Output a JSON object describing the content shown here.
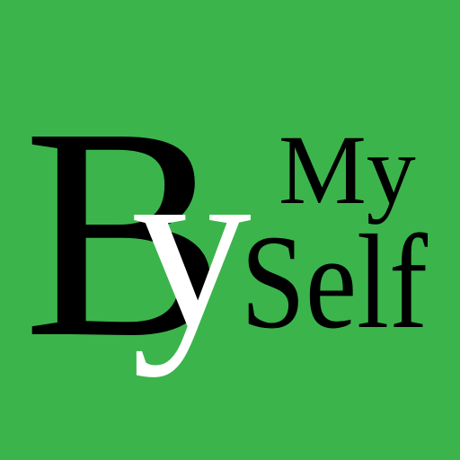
{
  "icon": {
    "background_color": "#3cb44c",
    "letter_color": "#000000",
    "accent_letter_color": "#ffffff",
    "logo": {
      "big_letter": "B",
      "small_letter": "y",
      "word_top": "My",
      "word_bottom": "Self"
    }
  }
}
